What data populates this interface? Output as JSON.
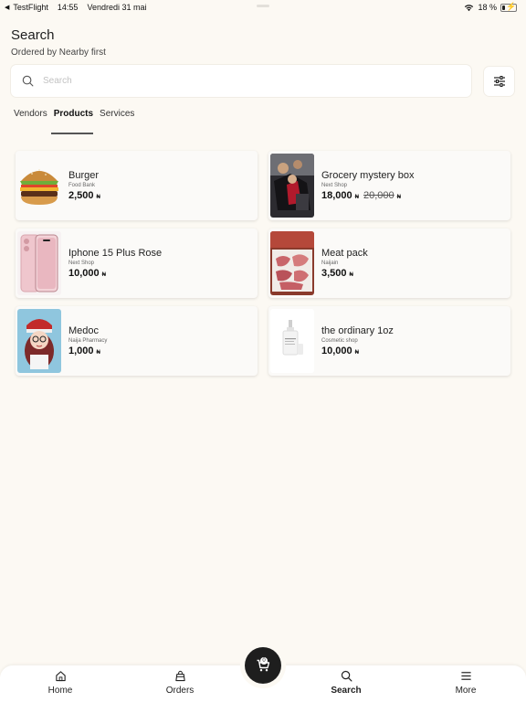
{
  "status_bar": {
    "back_app": "TestFlight",
    "time": "14:55",
    "date": "Vendredi 31 mai",
    "battery": "18 %",
    "battery_level": 0.18
  },
  "header": {
    "title": "Search",
    "subtitle": "Ordered by Nearby first"
  },
  "search": {
    "placeholder": "Search",
    "value": ""
  },
  "tabs": [
    {
      "label": "Vendors",
      "active": false
    },
    {
      "label": "Products",
      "active": true
    },
    {
      "label": "Services",
      "active": false
    }
  ],
  "products": [
    {
      "name": "Burger",
      "vendor": "Food Bank",
      "price": "2,500",
      "old_price": "",
      "currency": "₦",
      "image": "burger-image"
    },
    {
      "name": "Grocery mystery box",
      "vendor": "Next Shop",
      "price": "18,000",
      "old_price": "20,000",
      "currency": "₦",
      "image": "grocery-box-image"
    },
    {
      "name": "Iphone 15 Plus Rose",
      "vendor": "Next Shop",
      "price": "10,000",
      "old_price": "",
      "currency": "₦",
      "image": "iphone-image"
    },
    {
      "name": "Meat pack",
      "vendor": "Naijain",
      "price": "3,500",
      "old_price": "",
      "currency": "₦",
      "image": "meat-pack-image"
    },
    {
      "name": "Medoc",
      "vendor": "Naija Pharmacy",
      "price": "1,000",
      "old_price": "",
      "currency": "₦",
      "image": "medoc-image"
    },
    {
      "name": "the ordinary 1oz",
      "vendor": "Cosmetic shop",
      "price": "10,000",
      "old_price": "",
      "currency": "₦",
      "image": "cosmetic-bottle-image"
    }
  ],
  "cart": {
    "count": "0"
  },
  "bottom_nav": [
    {
      "label": "Home",
      "icon": "home-icon",
      "active": false
    },
    {
      "label": "Orders",
      "icon": "orders-icon",
      "active": false
    },
    {
      "label": "Search",
      "icon": "search-icon",
      "active": true
    },
    {
      "label": "More",
      "icon": "menu-icon",
      "active": false
    }
  ]
}
